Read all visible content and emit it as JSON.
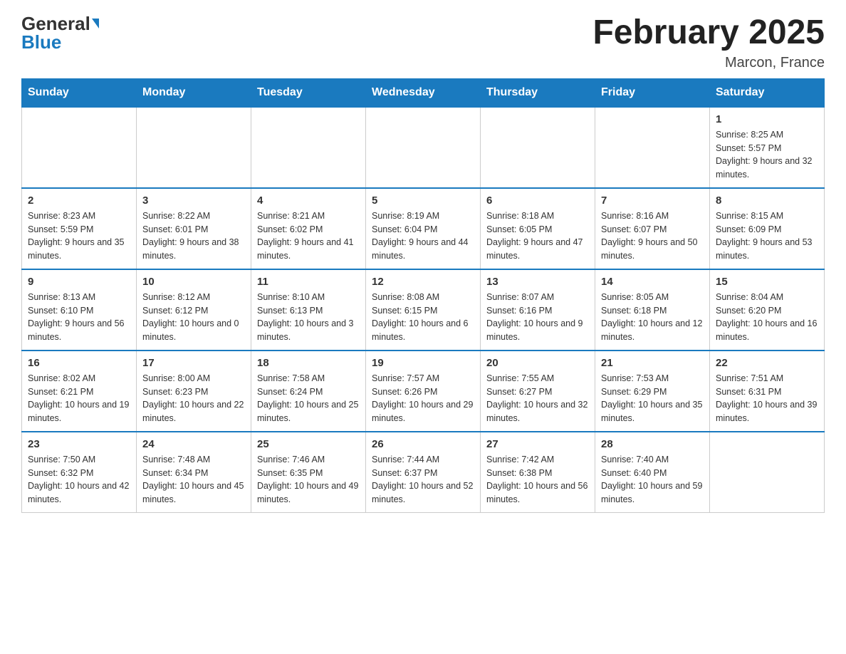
{
  "header": {
    "logo_general": "General",
    "logo_blue": "Blue",
    "month_title": "February 2025",
    "location": "Marcon, France"
  },
  "calendar": {
    "days_of_week": [
      "Sunday",
      "Monday",
      "Tuesday",
      "Wednesday",
      "Thursday",
      "Friday",
      "Saturday"
    ],
    "weeks": [
      [
        {
          "day": "",
          "info": ""
        },
        {
          "day": "",
          "info": ""
        },
        {
          "day": "",
          "info": ""
        },
        {
          "day": "",
          "info": ""
        },
        {
          "day": "",
          "info": ""
        },
        {
          "day": "",
          "info": ""
        },
        {
          "day": "1",
          "info": "Sunrise: 8:25 AM\nSunset: 5:57 PM\nDaylight: 9 hours and 32 minutes."
        }
      ],
      [
        {
          "day": "2",
          "info": "Sunrise: 8:23 AM\nSunset: 5:59 PM\nDaylight: 9 hours and 35 minutes."
        },
        {
          "day": "3",
          "info": "Sunrise: 8:22 AM\nSunset: 6:01 PM\nDaylight: 9 hours and 38 minutes."
        },
        {
          "day": "4",
          "info": "Sunrise: 8:21 AM\nSunset: 6:02 PM\nDaylight: 9 hours and 41 minutes."
        },
        {
          "day": "5",
          "info": "Sunrise: 8:19 AM\nSunset: 6:04 PM\nDaylight: 9 hours and 44 minutes."
        },
        {
          "day": "6",
          "info": "Sunrise: 8:18 AM\nSunset: 6:05 PM\nDaylight: 9 hours and 47 minutes."
        },
        {
          "day": "7",
          "info": "Sunrise: 8:16 AM\nSunset: 6:07 PM\nDaylight: 9 hours and 50 minutes."
        },
        {
          "day": "8",
          "info": "Sunrise: 8:15 AM\nSunset: 6:09 PM\nDaylight: 9 hours and 53 minutes."
        }
      ],
      [
        {
          "day": "9",
          "info": "Sunrise: 8:13 AM\nSunset: 6:10 PM\nDaylight: 9 hours and 56 minutes."
        },
        {
          "day": "10",
          "info": "Sunrise: 8:12 AM\nSunset: 6:12 PM\nDaylight: 10 hours and 0 minutes."
        },
        {
          "day": "11",
          "info": "Sunrise: 8:10 AM\nSunset: 6:13 PM\nDaylight: 10 hours and 3 minutes."
        },
        {
          "day": "12",
          "info": "Sunrise: 8:08 AM\nSunset: 6:15 PM\nDaylight: 10 hours and 6 minutes."
        },
        {
          "day": "13",
          "info": "Sunrise: 8:07 AM\nSunset: 6:16 PM\nDaylight: 10 hours and 9 minutes."
        },
        {
          "day": "14",
          "info": "Sunrise: 8:05 AM\nSunset: 6:18 PM\nDaylight: 10 hours and 12 minutes."
        },
        {
          "day": "15",
          "info": "Sunrise: 8:04 AM\nSunset: 6:20 PM\nDaylight: 10 hours and 16 minutes."
        }
      ],
      [
        {
          "day": "16",
          "info": "Sunrise: 8:02 AM\nSunset: 6:21 PM\nDaylight: 10 hours and 19 minutes."
        },
        {
          "day": "17",
          "info": "Sunrise: 8:00 AM\nSunset: 6:23 PM\nDaylight: 10 hours and 22 minutes."
        },
        {
          "day": "18",
          "info": "Sunrise: 7:58 AM\nSunset: 6:24 PM\nDaylight: 10 hours and 25 minutes."
        },
        {
          "day": "19",
          "info": "Sunrise: 7:57 AM\nSunset: 6:26 PM\nDaylight: 10 hours and 29 minutes."
        },
        {
          "day": "20",
          "info": "Sunrise: 7:55 AM\nSunset: 6:27 PM\nDaylight: 10 hours and 32 minutes."
        },
        {
          "day": "21",
          "info": "Sunrise: 7:53 AM\nSunset: 6:29 PM\nDaylight: 10 hours and 35 minutes."
        },
        {
          "day": "22",
          "info": "Sunrise: 7:51 AM\nSunset: 6:31 PM\nDaylight: 10 hours and 39 minutes."
        }
      ],
      [
        {
          "day": "23",
          "info": "Sunrise: 7:50 AM\nSunset: 6:32 PM\nDaylight: 10 hours and 42 minutes."
        },
        {
          "day": "24",
          "info": "Sunrise: 7:48 AM\nSunset: 6:34 PM\nDaylight: 10 hours and 45 minutes."
        },
        {
          "day": "25",
          "info": "Sunrise: 7:46 AM\nSunset: 6:35 PM\nDaylight: 10 hours and 49 minutes."
        },
        {
          "day": "26",
          "info": "Sunrise: 7:44 AM\nSunset: 6:37 PM\nDaylight: 10 hours and 52 minutes."
        },
        {
          "day": "27",
          "info": "Sunrise: 7:42 AM\nSunset: 6:38 PM\nDaylight: 10 hours and 56 minutes."
        },
        {
          "day": "28",
          "info": "Sunrise: 7:40 AM\nSunset: 6:40 PM\nDaylight: 10 hours and 59 minutes."
        },
        {
          "day": "",
          "info": ""
        }
      ]
    ]
  }
}
